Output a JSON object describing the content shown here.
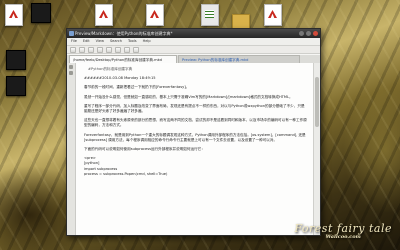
{
  "desktop": {
    "icons": [
      {
        "icon": "pdf-file-icon",
        "label": ""
      },
      {
        "icon": "video-file-icon",
        "label": ""
      },
      {
        "icon": "pdf-file-icon",
        "label": ""
      },
      {
        "icon": "pdf-file-icon",
        "label": ""
      },
      {
        "icon": "spreadsheet-file-icon",
        "label": ""
      },
      {
        "icon": "folder-icon",
        "label": ""
      },
      {
        "icon": "pdf-file-icon",
        "label": ""
      }
    ]
  },
  "window": {
    "title": "Preview/Markdown：使用Python的标准库创建字典*",
    "menu": [
      "File",
      "Edit",
      "View",
      "Search",
      "Tools",
      "Help"
    ],
    "tabs": [
      {
        "label": "/home/feelo/Desktop/Python的标准库创建字典.mkd",
        "active": true
      },
      {
        "label": "Preview: Python的标准库创建字典.mkd",
        "active": false
      }
    ],
    "editor_lines": [
      "#Python的标准库创建字典",
      "",
      "######2010-03-08 Monday 18:49:15",
      "",
      "春节前的一段时间，重新把看过一下就扔下的[Foreverfantasy]。",
      "",
      "虽然一开始没什么感觉，但是就如一直感叹的，基本上只需于准确Vim写的的[Markdown]/[markdown]格式的文档转换成HTML。",
      "",
      "重写了程序一部分代码，加入标题及改变了界面布局，发现还是有提点不一样的东西，对以与Python或wxpython的部分基础了不少，只是脑筋还是好头疼了好多遍遍了好多遍。",
      "",
      "这些天也一直想将着有头疼原来的部分的思想，而写这两不同的文档，尝试的却不是这看到同时和版本，以及市场中的编码可以有一种工作原型的编码，方法和方式。",
      "",
      "Foreverfantasy，就是用到Python一个重大的标题调发现这种方式，Python调用外部程序的方法包括。[os.system]，[command], 还是[subprocess] 调用方法，每个程序调用相应的命令行命令行主要就是上可以有一个文件去设置，以及设置了一种可以对。",
      "",
      "下面的代码可以说明如何使用subprocess运行外部程序并说明如何运行它：",
      "",
      "<pre>",
      "[python]",
      "import subprocess",
      "process = subprocess.Popen(cmd, shell=True)"
    ]
  },
  "watermark": {
    "title": "Forest fairy tale",
    "sub": "Wallcoo.com"
  }
}
